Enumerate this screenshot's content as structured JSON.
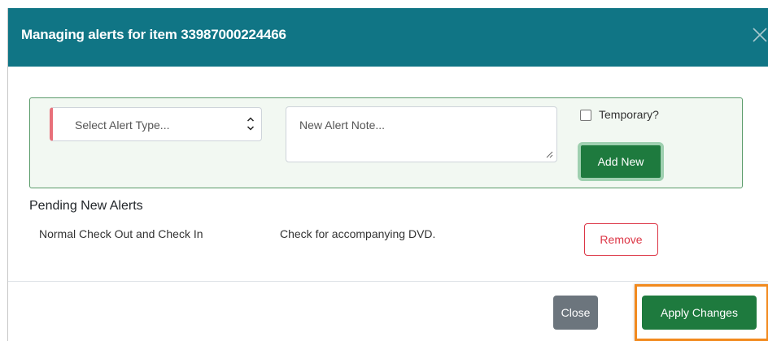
{
  "modal": {
    "title": "Managing alerts for item 33987000224466",
    "close_icon": "close-x-icon"
  },
  "form": {
    "alert_type_placeholder": "Select Alert Type...",
    "note_placeholder": "New Alert Note...",
    "temporary_label": "Temporary?",
    "temporary_checked": false,
    "add_button": "Add New"
  },
  "pending": {
    "heading": "Pending New Alerts",
    "items": [
      {
        "type": "Normal Check Out and Check In",
        "note": "Check for accompanying DVD.",
        "remove_label": "Remove"
      }
    ]
  },
  "footer": {
    "close_label": "Close",
    "apply_label": "Apply Changes"
  },
  "colors": {
    "header": "#107585",
    "primary_green": "#1e7a3e",
    "danger": "#dc3545",
    "secondary": "#6c757d",
    "highlight": "#f28a1e"
  }
}
